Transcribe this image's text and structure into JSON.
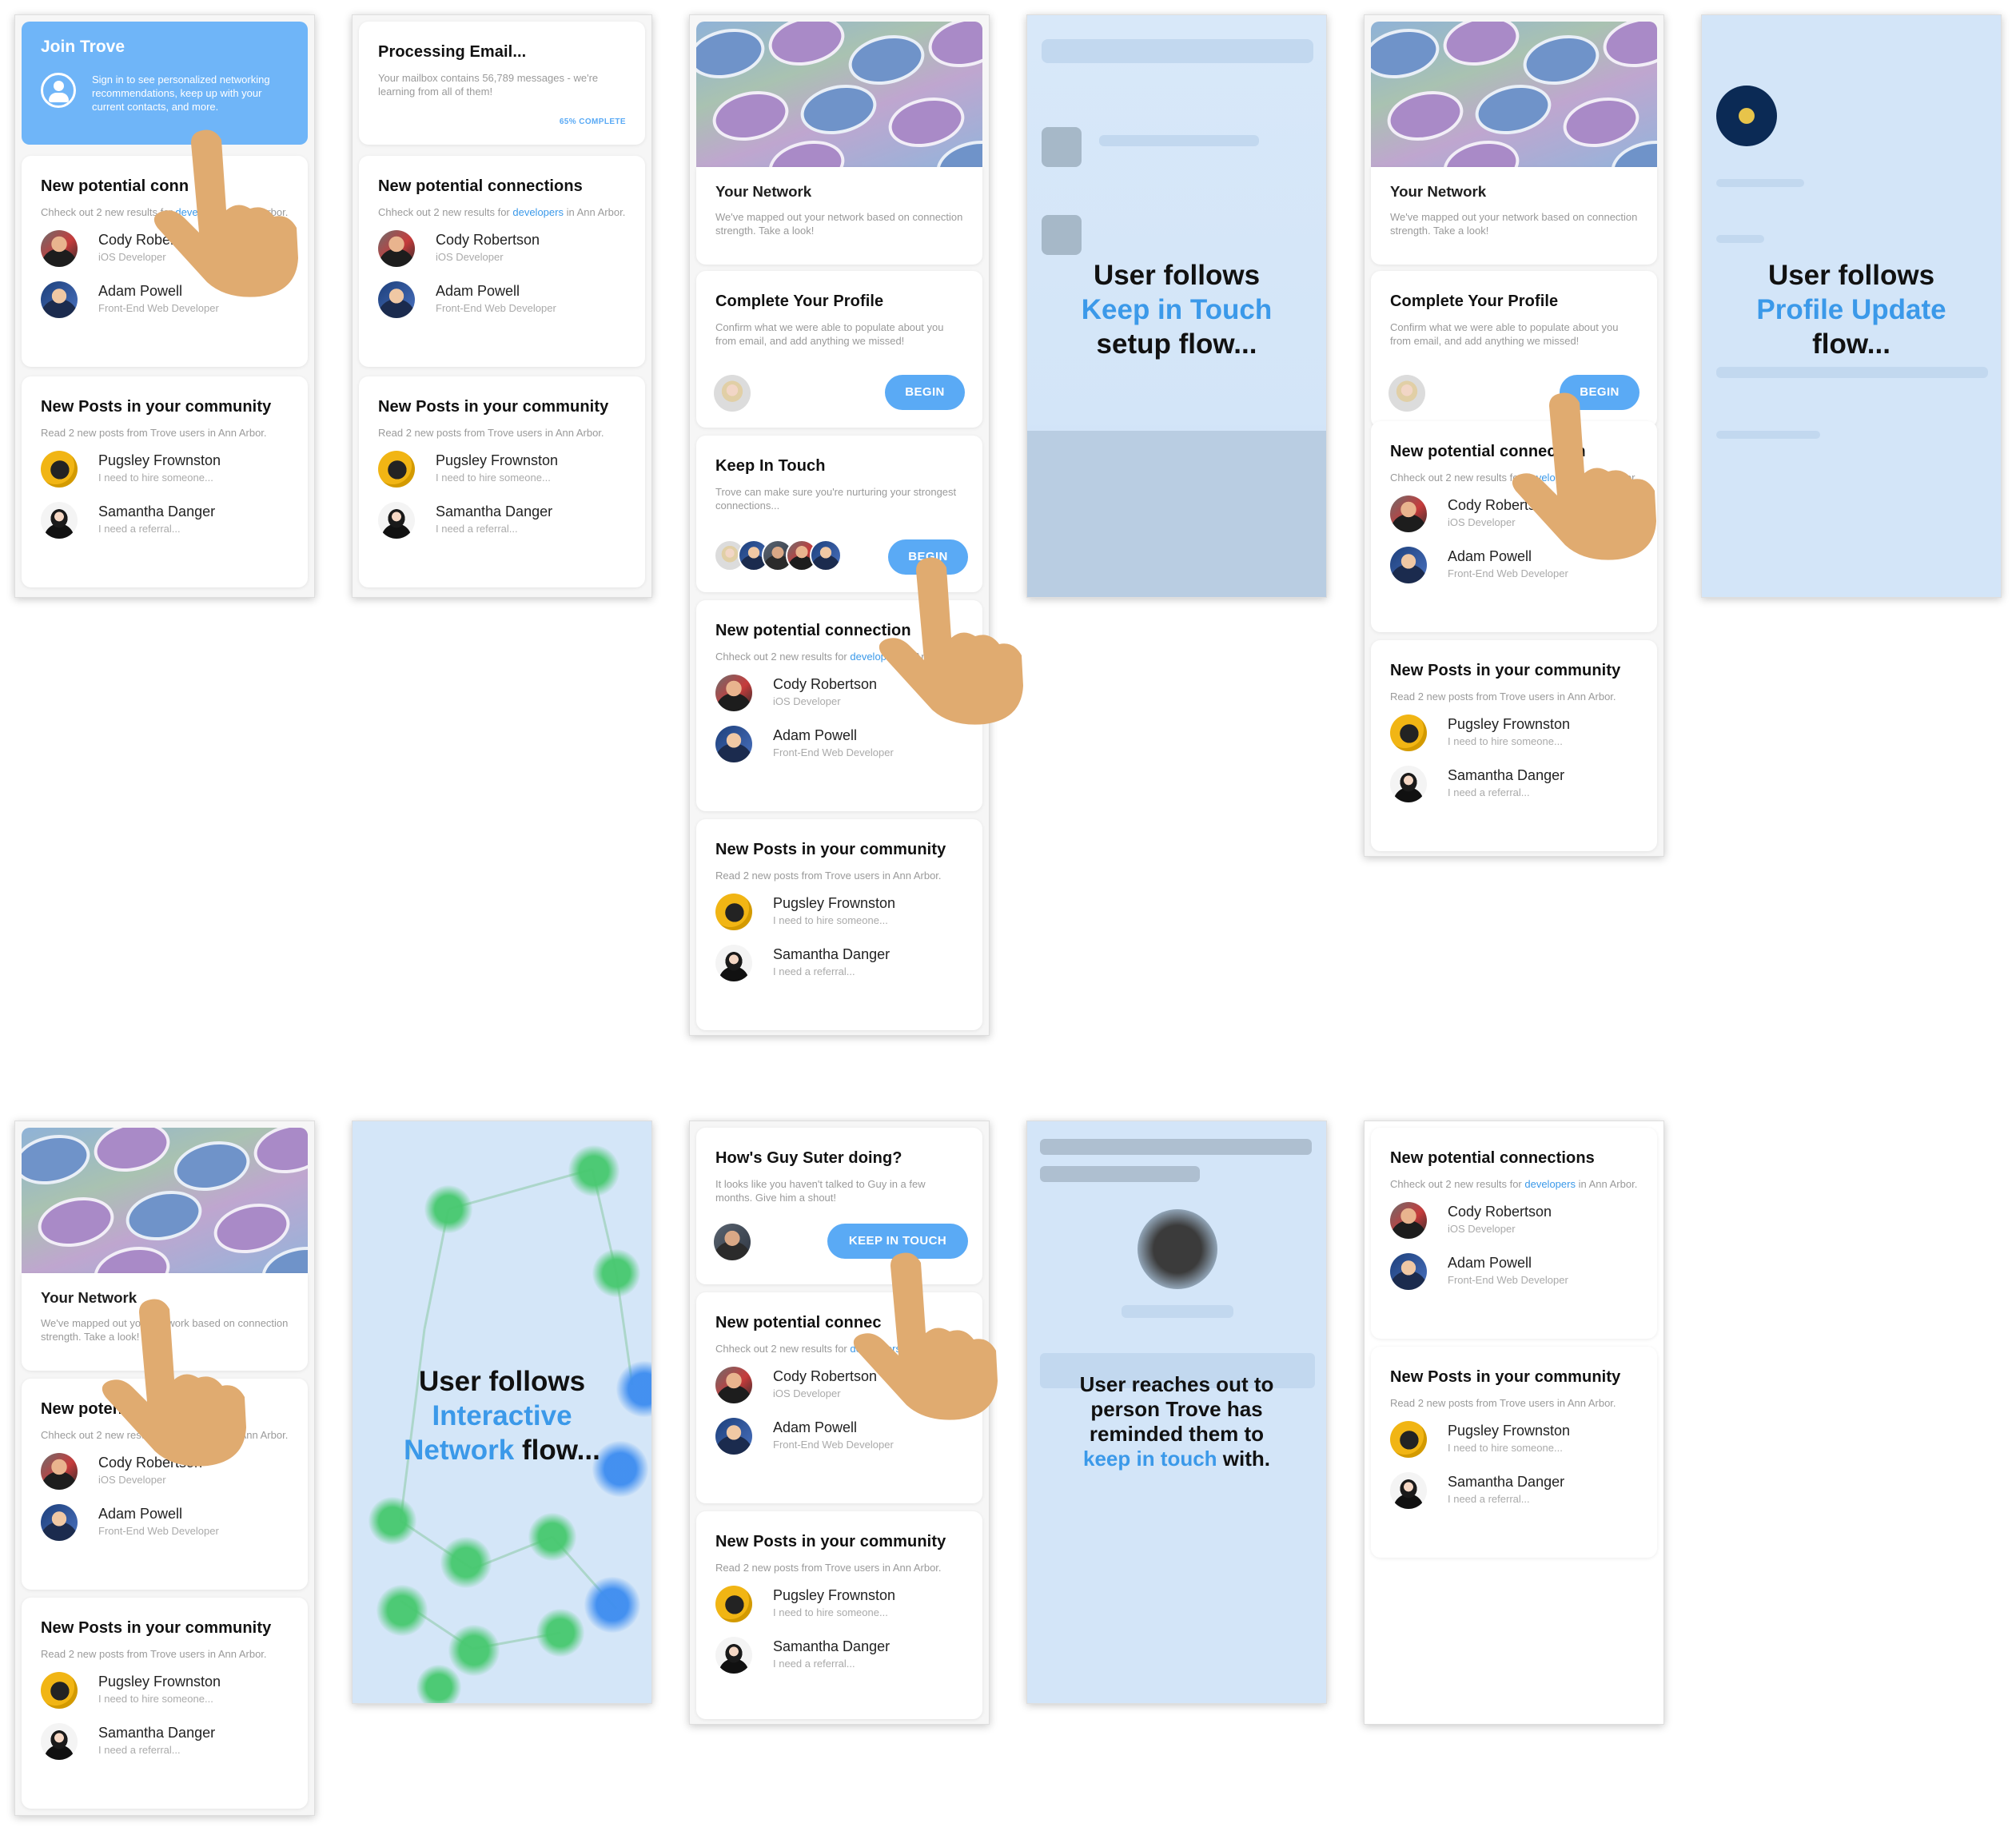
{
  "colors": {
    "accent": "#5aaaf5",
    "link": "#3b99e9",
    "join_panel": "#6fb5f8",
    "overlay": "#d3e5f8",
    "hand": "#e0ab70"
  },
  "people": {
    "cody": {
      "name": "Cody Robertson",
      "role": "iOS Developer"
    },
    "adam": {
      "name": "Adam Powell",
      "role": "Front-End Web Developer"
    },
    "pugsley": {
      "name": "Pugsley Frownston",
      "msg": "I need to hire someone..."
    },
    "samantha": {
      "name": "Samantha Danger",
      "msg": "I need a referral..."
    }
  },
  "cards": {
    "join": {
      "title": "Join Trove",
      "text": "Sign in to see personalized networking recommendations, keep up with your current contacts, and more.",
      "icon": "user-circle-icon"
    },
    "processing": {
      "title": "Processing Email...",
      "text": "Your mailbox contains 56,789 messages - we're learning from all of them!",
      "progress_label": "65% COMPLETE",
      "progress": 0.65
    },
    "connections": {
      "title": "New potential connections",
      "desc_prefix": "Chheck out 2 new results for ",
      "desc_link": "developers",
      "desc_suffix": " in Ann Arbor."
    },
    "connections_cut_a": "New potential conn",
    "connections_cut_b": "New potential connection",
    "connections_cut_c": "New potential connec",
    "posts": {
      "title": "New Posts in your community",
      "desc": "Read 2 new posts from Trove users in Ann Arbor."
    },
    "network": {
      "title": "Your Network",
      "desc": "We've mapped out your network based on connection strength. Take a look!"
    },
    "profile": {
      "title": "Complete Your Profile",
      "desc": "Confirm what we were able to populate about you from email, and add anything we missed!",
      "button": "BEGIN"
    },
    "keep_in_touch": {
      "title": "Keep In Touch",
      "desc": "Trove can make sure you're nurturing your strongest connections...",
      "button": "BEGIN"
    },
    "guy": {
      "title": "How's Guy Suter doing?",
      "desc": "It looks like you haven't talked to Guy in a few months. Give him a shout!",
      "button": "KEEP IN TOUCH"
    }
  },
  "overlays": {
    "keep_in_touch": {
      "line1": "User follows",
      "line2": "Keep in Touch",
      "line3": "setup flow..."
    },
    "profile_update": {
      "line1": "User follows",
      "line2": "Profile Update",
      "line3": "flow..."
    },
    "network": {
      "line1": "User follows",
      "line2": "Interactive",
      "line3a": "Network",
      "line3b": " flow..."
    },
    "reach_out": {
      "text1": "User reaches out to person Trove has reminded them to ",
      "link": "keep in touch",
      "text2": " with."
    }
  }
}
